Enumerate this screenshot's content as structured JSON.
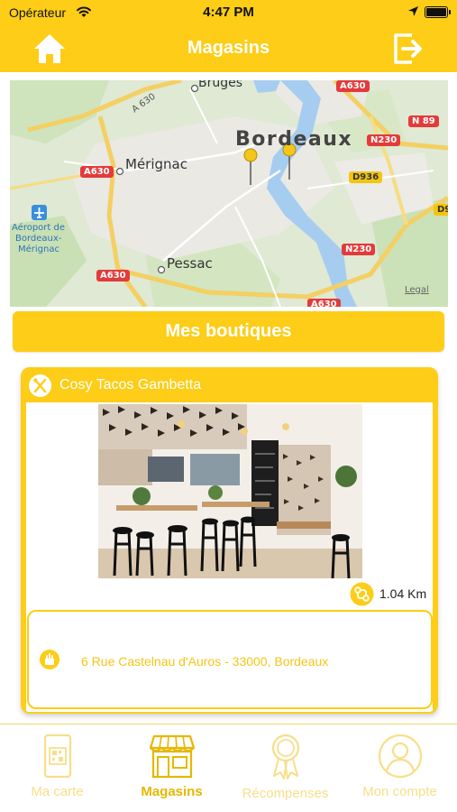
{
  "status_bar": {
    "carrier": "Opérateur",
    "time": "4:47 PM"
  },
  "nav": {
    "title": "Magasins",
    "home_icon": "home-icon",
    "logout_icon": "logout-icon"
  },
  "map": {
    "legal": "Legal",
    "places": [
      "Bordeaux",
      "Mérignac",
      "Pessac",
      "Bruges",
      "Aéroport de",
      "Bordeaux-",
      "Mérignac"
    ],
    "roads": [
      "A 630",
      "A630",
      "A630",
      "A630",
      "A630",
      "N 89",
      "N230",
      "D936",
      "N230",
      "D9"
    ]
  },
  "primary_button": {
    "label": "Mes boutiques"
  },
  "store": {
    "name": "Cosy Tacos Gambetta",
    "distance": "1.04 Km",
    "address": "6 Rue Castelnau d'Auros - 33000, Bordeaux"
  },
  "tabs": [
    {
      "label": "Ma carte",
      "icon": "card-icon",
      "active": false
    },
    {
      "label": "Magasins",
      "icon": "store-icon",
      "active": true
    },
    {
      "label": "Récompenses",
      "icon": "medal-icon",
      "active": false
    },
    {
      "label": "Mon compte",
      "icon": "account-icon",
      "active": false
    }
  ],
  "colors": {
    "accent": "#fdcd17",
    "inactive_tab": "#f7df8a",
    "active_tab": "#e6b800"
  }
}
